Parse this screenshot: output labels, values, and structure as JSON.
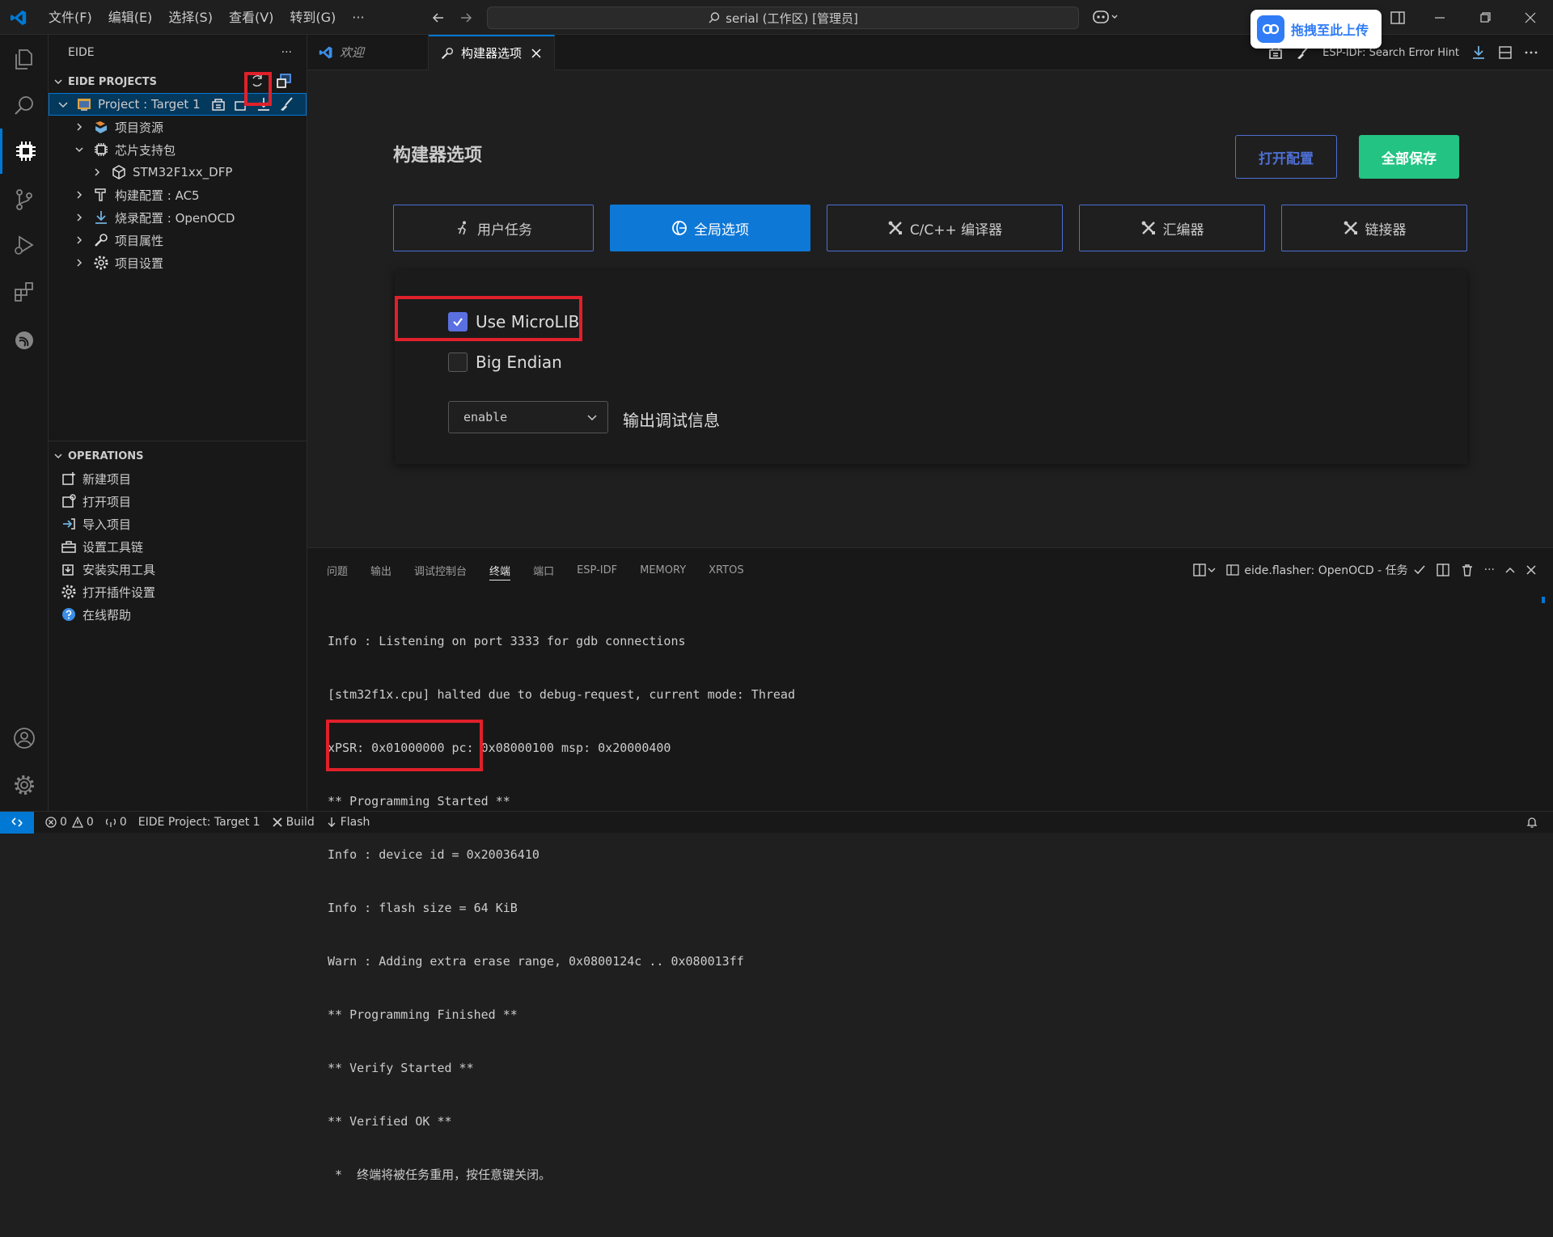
{
  "titlebar": {
    "menus": [
      "文件(F)",
      "编辑(E)",
      "选择(S)",
      "查看(V)",
      "转到(G)",
      "···"
    ],
    "command_center": "serial (工作区) [管理员]",
    "upload_label": "拖拽至此上传"
  },
  "sidebar": {
    "title": "EIDE",
    "more": "···",
    "projects_header": "EIDE PROJECTS",
    "project_label": "Project : Target 1",
    "tree": [
      {
        "label": "项目资源",
        "icon": "resources-icon"
      },
      {
        "label": "芯片支持包",
        "icon": "chip-icon"
      },
      {
        "label": "STM32F1xx_DFP",
        "icon": "package-icon"
      },
      {
        "label": "构建配置 : AC5",
        "icon": "build-config-icon"
      },
      {
        "label": "烧录配置 : OpenOCD",
        "icon": "flash-config-icon"
      },
      {
        "label": "项目属性",
        "icon": "wrench-icon"
      },
      {
        "label": "项目设置",
        "icon": "gear-icon"
      }
    ],
    "operations_header": "OPERATIONS",
    "operations": [
      {
        "label": "新建项目"
      },
      {
        "label": "打开项目"
      },
      {
        "label": "导入项目"
      },
      {
        "label": "设置工具链"
      },
      {
        "label": "安装实用工具"
      },
      {
        "label": "打开插件设置"
      },
      {
        "label": "在线帮助"
      }
    ]
  },
  "tabs": {
    "welcome": "欢迎",
    "builder": "构建器选项",
    "esp_hint": "ESP-IDF: Search Error Hint"
  },
  "builder": {
    "title": "构建器选项",
    "open_config": "打开配置",
    "save_all": "全部保存",
    "tabs": [
      "用户任务",
      "全局选项",
      "C/C++ 编译器",
      "汇编器",
      "链接器"
    ],
    "options": {
      "use_microlib": {
        "label": "Use MicroLIB",
        "checked": true
      },
      "big_endian": {
        "label": "Big Endian",
        "checked": false
      },
      "debug_select_value": "enable",
      "debug_label": "输出调试信息"
    }
  },
  "panel": {
    "tabs": [
      "问题",
      "输出",
      "调试控制台",
      "终端",
      "端口",
      "ESP-IDF",
      "MEMORY",
      "XRTOS"
    ],
    "active_tab": "终端",
    "task_label": "eide.flasher: OpenOCD - 任务",
    "more": "···",
    "terminal_lines": [
      "Info : Listening on port 3333 for gdb connections",
      "[stm32f1x.cpu] halted due to debug-request, current mode: Thread",
      "xPSR: 0x01000000 pc: 0x08000100 msp: 0x20000400",
      "** Programming Started **",
      "Info : device id = 0x20036410",
      "Info : flash size = 64 KiB",
      "Warn : Adding extra erase range, 0x0800124c .. 0x080013ff",
      "** Programming Finished **",
      "** Verify Started **",
      "** Verified OK **"
    ],
    "terminal_note": " *  终端将被任务重用，按任意键关闭。"
  },
  "statusbar": {
    "errors": "0",
    "warnings": "0",
    "ports": "0",
    "project": "EIDE Project: Target 1",
    "build": "Build",
    "flash": "Flash"
  },
  "colors": {
    "accent": "#0078d4",
    "save_green": "#23c483",
    "tab_border": "#4e6fd4",
    "highlight_red": "#e0202a"
  }
}
